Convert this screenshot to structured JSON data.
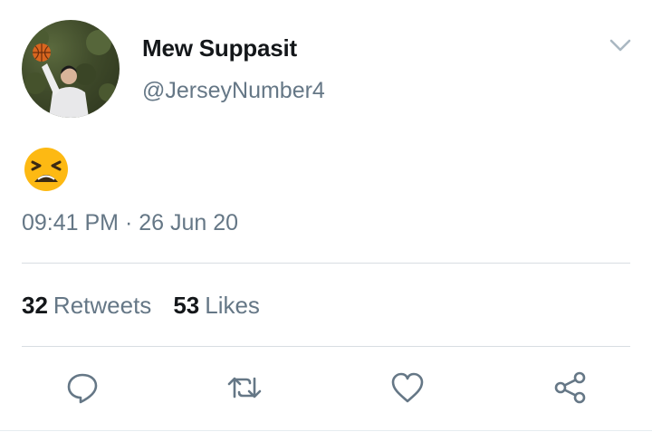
{
  "tweet": {
    "author": {
      "display_name": "Mew Suppasit",
      "handle": "@JerseyNumber4",
      "avatar_icon": "profile-photo-basketball"
    },
    "content_emoji": "tired-face-emoji",
    "timestamp": "09:41 PM · 26 Jun 20"
  },
  "stats": {
    "retweets_count": "32",
    "retweets_label": "Retweets",
    "likes_count": "53",
    "likes_label": "Likes"
  },
  "actions": [
    {
      "name": "reply",
      "icon": "speech-bubble-icon"
    },
    {
      "name": "retweet",
      "icon": "retweet-arrows-icon"
    },
    {
      "name": "like",
      "icon": "heart-icon"
    },
    {
      "name": "share",
      "icon": "share-nodes-icon"
    }
  ],
  "colors": {
    "primary_text": "#14171a",
    "secondary_text": "#657786",
    "icon_gray": "#657786",
    "divider": "#d8dde2",
    "emoji_yellow": "#fdb913"
  }
}
